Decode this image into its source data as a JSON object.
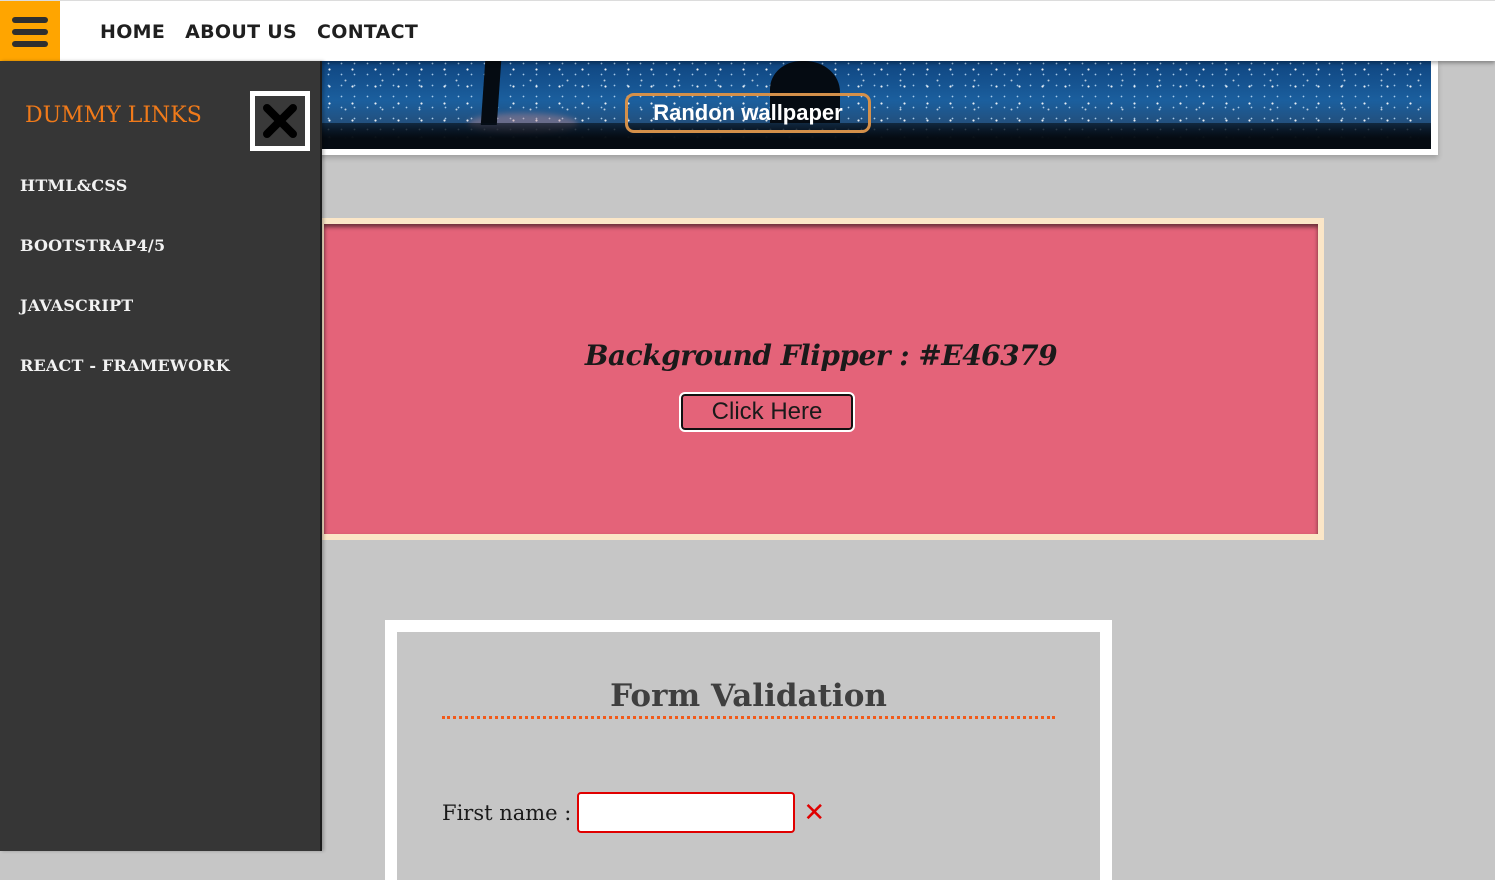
{
  "topbar": {
    "menu_icon": "hamburger-menu-icon",
    "nav": [
      {
        "label": "HOME"
      },
      {
        "label": "ABOUT US"
      },
      {
        "label": "CONTACT"
      }
    ]
  },
  "sidebar": {
    "title": "DUMMY LINKS",
    "close_icon": "close-x-icon",
    "links": [
      {
        "label": "HTML&CSS"
      },
      {
        "label": "BOOTSTRAP4/5"
      },
      {
        "label": "JAVASCRIPT"
      },
      {
        "label": "REACT - FRAMEWORK"
      }
    ]
  },
  "hero": {
    "button_label": "Randon wallpaper"
  },
  "flipper": {
    "title": "Background Flipper : #E46379",
    "button_label": "Click Here",
    "background_color": "#E46379"
  },
  "form": {
    "title": "Form Validation",
    "first_name_label": "First name :",
    "first_name_value": "",
    "error_icon": "✕"
  },
  "colors": {
    "accent_orange": "#ffa500",
    "sidebar_bg": "#363636",
    "sidebar_title": "#f07a1a",
    "error_red": "#e00000",
    "page_bg": "#c6c6c6"
  }
}
